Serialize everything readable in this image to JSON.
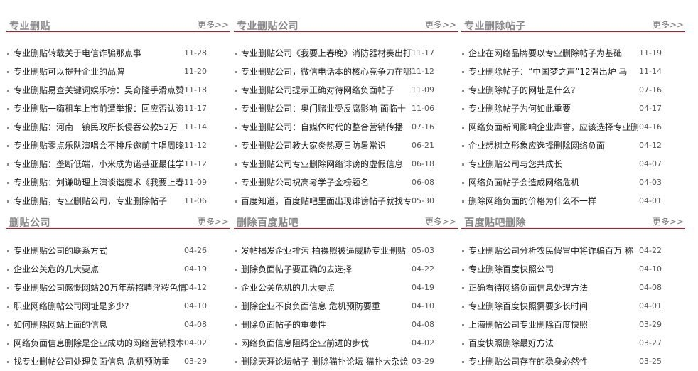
{
  "sections": [
    {
      "title": "专业删贴",
      "more": "更多>>",
      "items": [
        {
          "t": "专业删贴转载关于电信诈骗那点事",
          "d": "11-28"
        },
        {
          "t": "专业删贴可以提升企业的品牌",
          "d": "11-20"
        },
        {
          "t": "专业删贴易查关键词娱乐榜：吴奇隆手滑点赞",
          "d": "11-18"
        },
        {
          "t": "专业删贴一嗨租车上市前遭举报：回应否认资",
          "d": "11-17"
        },
        {
          "t": "专业删贴：河南一镇民政所长侵吞公款52万",
          "d": "11-14"
        },
        {
          "t": "专业删贴零点乐队演唱会不排斥邀前主唱周晓",
          "d": "11-12"
        },
        {
          "t": "专业删贴：垄断低端，小米成为诺基亚最佳学",
          "d": "11-12"
        },
        {
          "t": "专业删贴：刘谦助理上演谈谐魔术《我要上春",
          "d": "11-09"
        },
        {
          "t": "专业删贴，专业删贴公司，专业删除帖子",
          "d": "11-06"
        }
      ]
    },
    {
      "title": "专业删贴公司",
      "more": "更多>>",
      "items": [
        {
          "t": "专业删贴公司《我要上春晚》消防器材奏出打",
          "d": "11-17"
        },
        {
          "t": "专业删贴公司，微信电话本的核心竞争力在哪",
          "d": "11-12"
        },
        {
          "t": "专业删贴公司提示正确对待网络负面帖子",
          "d": "11-09"
        },
        {
          "t": "专业删贴公司：奥门赌业受反腐影响 面临十",
          "d": "11-06"
        },
        {
          "t": "专业删贴公司：自媒体时代的整合营销传播",
          "d": "07-16"
        },
        {
          "t": "专业删贴公司教大家炎热夏日防暑常识",
          "d": "06-21"
        },
        {
          "t": "专业删贴公司专业删除网络诽谤的虚假信息",
          "d": "06-18"
        },
        {
          "t": "专业删贴公司祝高考学子金榜题名",
          "d": "06-08"
        },
        {
          "t": "百度知道，百度贴吧里面出现诽谤帖子就找专",
          "d": "05-30"
        }
      ]
    },
    {
      "title": "专业删除帖子",
      "more": "更多>>",
      "items": [
        {
          "t": "企业在网络品牌要以专业删除帖子为基础",
          "d": "11-19"
        },
        {
          "t": "专业删除帖子：“中国梦之声”12强出炉 马",
          "d": "11-14"
        },
        {
          "t": "专业删除帖子的网址是什么?",
          "d": "07-16"
        },
        {
          "t": "专业删除帖子为何如此重要",
          "d": "04-17"
        },
        {
          "t": "网络负面新闻影响企业声誉，应该选择专业删",
          "d": "04-16"
        },
        {
          "t": "企业想树立形象应选择删除网络负面",
          "d": "04-12"
        },
        {
          "t": "专业删贴公司与您共成长",
          "d": "04-07"
        },
        {
          "t": "网络负面帖子会造成网络危机",
          "d": "04-03"
        },
        {
          "t": "删除网络负面的价格为什么不一样",
          "d": "04-01"
        }
      ]
    },
    {
      "title": "删贴公司",
      "more": "更多>>",
      "items": [
        {
          "t": "专业删贴公司的联系方式",
          "d": "04-26"
        },
        {
          "t": "企业公关危的几大要点",
          "d": "04-19"
        },
        {
          "t": "专业删贴公司感慨网站20万年薪招聘淫秽色情",
          "d": "04-12"
        },
        {
          "t": "职业网络删帖公司网址是多少?",
          "d": "04-10"
        },
        {
          "t": "如何删除网站上面的信息",
          "d": "04-08"
        },
        {
          "t": "网络负面信息删除是企业成功的网络营销根本",
          "d": "04-02"
        },
        {
          "t": "找专业删帖公司处理负面信息 危机预防重",
          "d": "03-29"
        }
      ]
    },
    {
      "title": "删除百度贴吧",
      "more": "更多>>",
      "items": [
        {
          "t": "发帖揭发企业排污 拍裸照被逼威胁专业删贴",
          "d": "05-03"
        },
        {
          "t": "删除负面帖子要正确的去选择",
          "d": "04-22"
        },
        {
          "t": "企业公关危机的几大要点",
          "d": "04-19"
        },
        {
          "t": "删除企业不良负面信息 危机预防要重",
          "d": "04-10"
        },
        {
          "t": "删除负面帖子的重要性",
          "d": "04-08"
        },
        {
          "t": "网络负面信息阻碍企业前进的步伐",
          "d": "04-02"
        },
        {
          "t": "删除天涯论坛帖子 删除猫扑论坛 猫扑大杂烩",
          "d": "03-29"
        }
      ]
    },
    {
      "title": "百度贴吧删除",
      "more": "更多>>",
      "items": [
        {
          "t": "专业删贴公司分析农民假冒中将诈骗百万 称",
          "d": "04-22"
        },
        {
          "t": "专业删除百度快照公司",
          "d": "04-10"
        },
        {
          "t": "正确看待网络负面信息处理方法",
          "d": "04-08"
        },
        {
          "t": "专业删除百度快照需要多长时间",
          "d": "04-01"
        },
        {
          "t": "上海删帖公司专业删除百度快照",
          "d": "03-29"
        },
        {
          "t": "百度快照删除最好方法",
          "d": "03-27"
        },
        {
          "t": "专业删贴公司存在的稳身必然性",
          "d": "03-25"
        }
      ]
    }
  ]
}
